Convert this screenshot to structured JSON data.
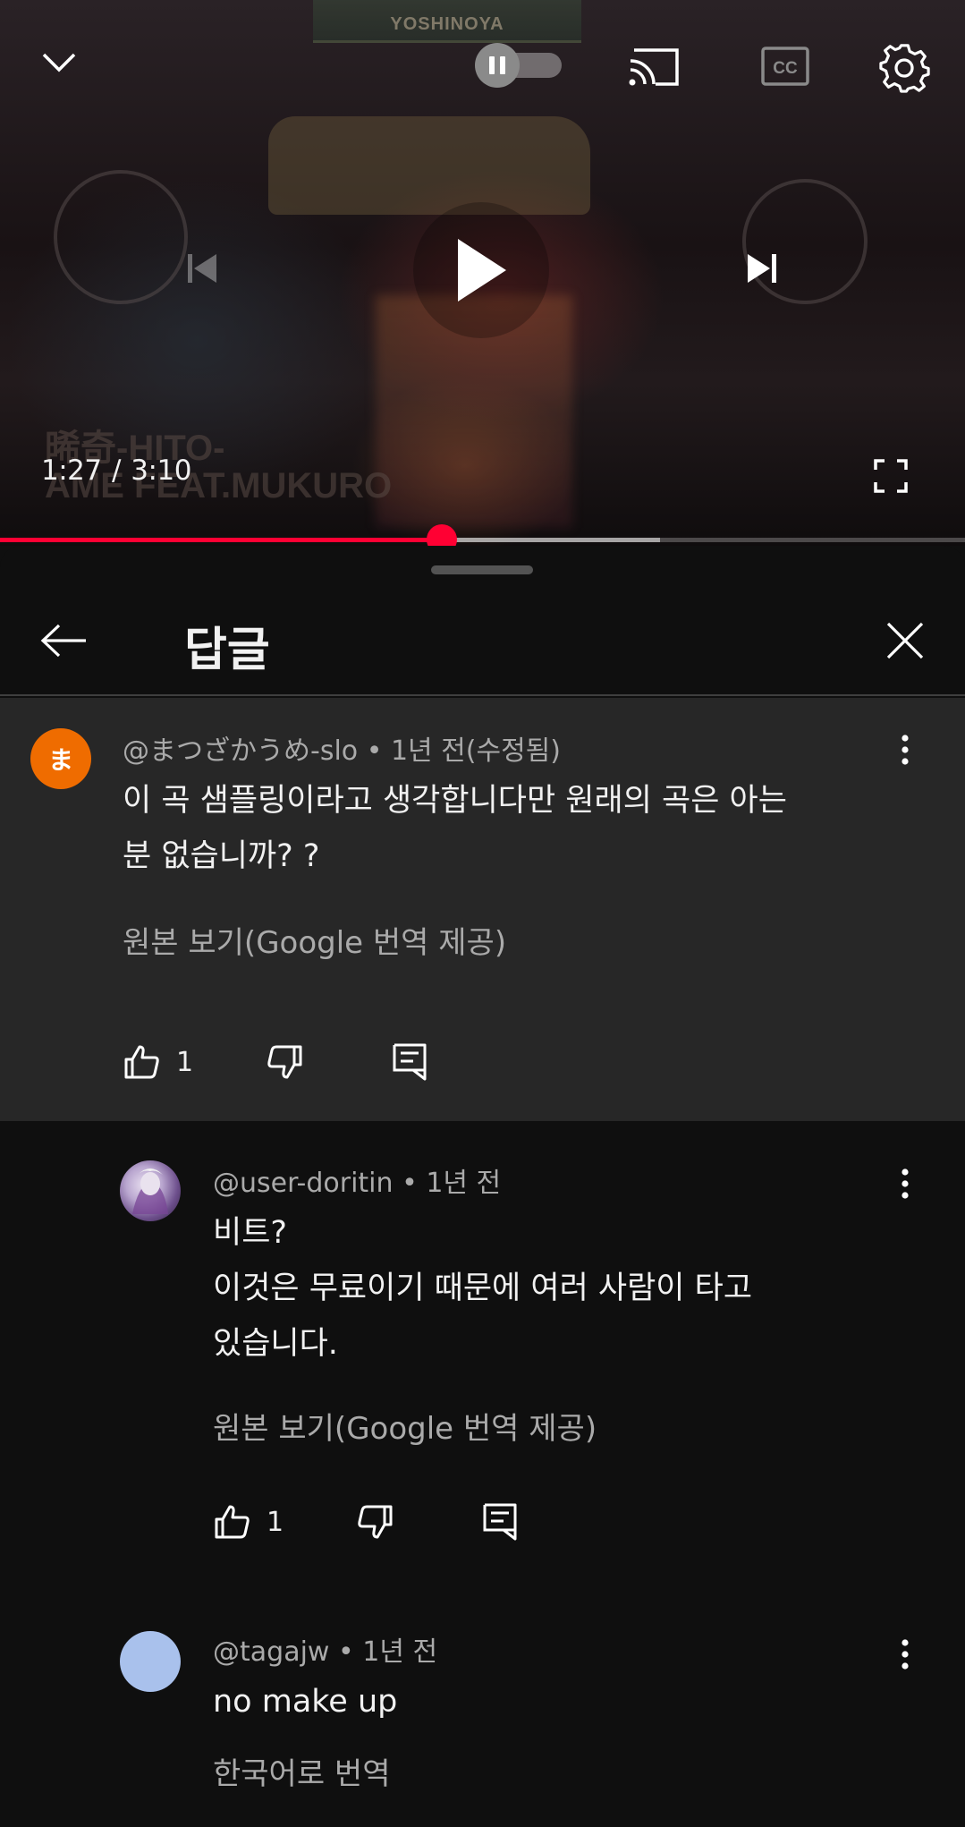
{
  "player": {
    "sign_text": "YOSHINOYA",
    "watermark_line1": "晞奇-HITO-",
    "watermark_line2": "AME FEAT.MUKURO",
    "current_time": "1:27",
    "separator": "/",
    "duration": "3:10",
    "progress_fraction": 0.458,
    "buffer_fraction": 0.684,
    "accent_color": "#ff0033",
    "icons": [
      "chevron-down-icon",
      "pause-toggle-icon",
      "cast-icon",
      "captions-icon",
      "settings-gear-icon",
      "previous-icon",
      "play-icon",
      "next-icon",
      "fullscreen-icon"
    ],
    "captions_label": "CC"
  },
  "panel": {
    "title": "답글",
    "back_icon": "arrow-left-icon",
    "close_icon": "close-icon"
  },
  "comments": [
    {
      "avatar_letter": "ま",
      "avatar_color": "#ef6c00",
      "author": "@まつざかうめ-slo",
      "time": "1년 전(수정됨)",
      "body_lines": [
        "이 곡 샘플링이라고 생각합니다만 원래의 곡은 아는",
        "분 없습니까? ?"
      ],
      "translate_label": "원본 보기(Google 번역 제공)",
      "likes": "1"
    },
    {
      "author": "@user-doritin",
      "time": "1년 전",
      "body_lines": [
        "비트?",
        "이것은 무료이기 때문에 여러 사람이 타고",
        "있습니다."
      ],
      "translate_label": "원본 보기(Google 번역 제공)",
      "likes": "1"
    },
    {
      "avatar_color": "#a9c1ec",
      "author": "@tagajw",
      "time": "1년 전",
      "body_lines": [
        "no make up"
      ],
      "translate_label": "한국어로 번역"
    }
  ],
  "meta_dot": "•"
}
